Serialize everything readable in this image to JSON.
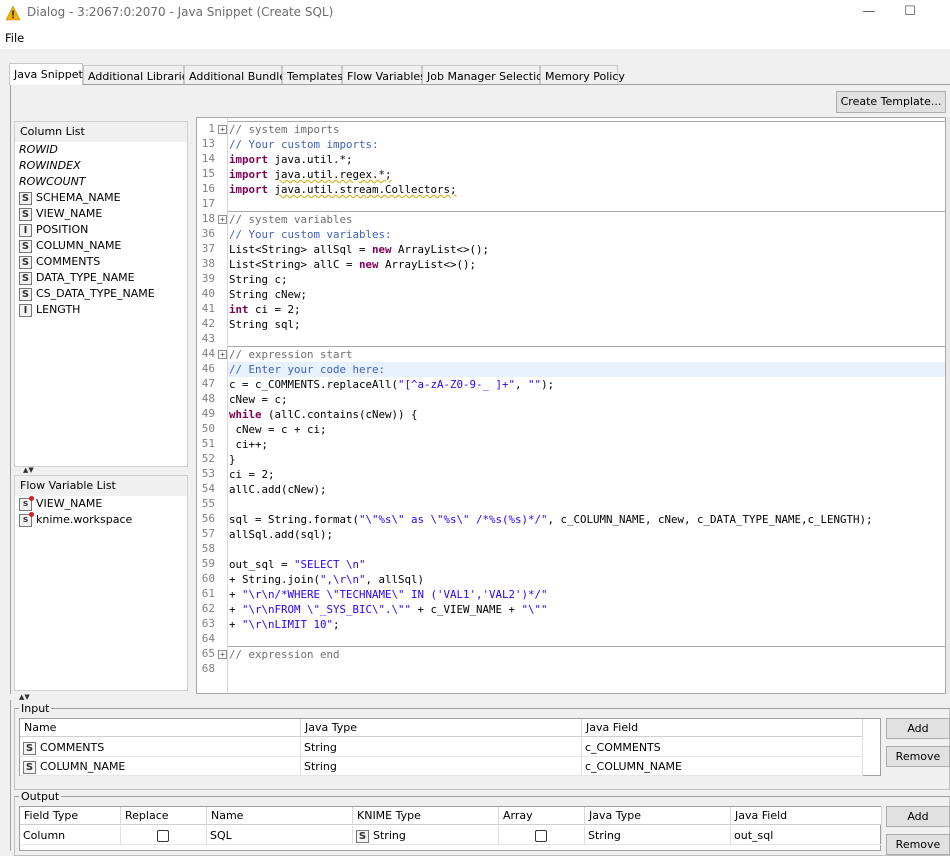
{
  "window": {
    "title": "Dialog - 3:2067:0:2070 - Java Snippet (Create SQL)",
    "minimize_glyph": "—",
    "maximize_glyph": "☐"
  },
  "menu": {
    "file": "File"
  },
  "tabs": [
    "Java Snippet",
    "Additional Libraries",
    "Additional Bundles",
    "Templates",
    "Flow Variables",
    "Job Manager Selection",
    "Memory Policy"
  ],
  "toolbar": {
    "create_template": "Create Template..."
  },
  "column_list": {
    "header": "Column List",
    "items": [
      {
        "type": "",
        "label": "ROWID"
      },
      {
        "type": "",
        "label": "ROWINDEX"
      },
      {
        "type": "",
        "label": "ROWCOUNT"
      },
      {
        "type": "S",
        "label": "SCHEMA_NAME"
      },
      {
        "type": "S",
        "label": "VIEW_NAME"
      },
      {
        "type": "I",
        "label": "POSITION"
      },
      {
        "type": "S",
        "label": "COLUMN_NAME"
      },
      {
        "type": "S",
        "label": "COMMENTS"
      },
      {
        "type": "S",
        "label": "DATA_TYPE_NAME"
      },
      {
        "type": "S",
        "label": "CS_DATA_TYPE_NAME"
      },
      {
        "type": "I",
        "label": "LENGTH"
      }
    ]
  },
  "flow_variable_list": {
    "header": "Flow Variable List",
    "items": [
      {
        "type": "s",
        "label": "VIEW_NAME"
      },
      {
        "type": "s",
        "label": "knime.workspace"
      }
    ]
  },
  "code_lines": [
    {
      "n": "1",
      "fold": true,
      "guard": false,
      "t": "// system imports"
    },
    {
      "n": "13",
      "fold": false,
      "guard": true,
      "t": "// Your custom imports:"
    },
    {
      "n": "14",
      "fold": false,
      "guard": false,
      "t": "import java.util.*;"
    },
    {
      "n": "15",
      "fold": false,
      "guard": false,
      "t": "import java.util.regex.*;"
    },
    {
      "n": "16",
      "fold": false,
      "guard": false,
      "t": "import java.util.stream.Collectors;"
    },
    {
      "n": "17",
      "fold": false,
      "guard": false,
      "t": ""
    },
    {
      "n": "18",
      "fold": true,
      "guard": false,
      "t": "// system variables"
    },
    {
      "n": "36",
      "fold": false,
      "guard": true,
      "t": "// Your custom variables:"
    },
    {
      "n": "37",
      "fold": false,
      "guard": false,
      "t": "List<String> allSql = new ArrayList<>();"
    },
    {
      "n": "38",
      "fold": false,
      "guard": false,
      "t": "List<String> allC = new ArrayList<>();"
    },
    {
      "n": "39",
      "fold": false,
      "guard": false,
      "t": "String c;"
    },
    {
      "n": "40",
      "fold": false,
      "guard": false,
      "t": "String cNew;"
    },
    {
      "n": "41",
      "fold": false,
      "guard": false,
      "t": "int ci = 2;"
    },
    {
      "n": "42",
      "fold": false,
      "guard": false,
      "t": "String sql;"
    },
    {
      "n": "43",
      "fold": false,
      "guard": false,
      "t": ""
    },
    {
      "n": "44",
      "fold": true,
      "guard": false,
      "t": "// expression start"
    },
    {
      "n": "46",
      "fold": false,
      "guard": true,
      "t": "// Enter your code here:"
    },
    {
      "n": "47",
      "fold": false,
      "guard": false,
      "t": "c = c_COMMENTS.replaceAll(\"[^a-zA-Z0-9-_ ]+\", \"\");"
    },
    {
      "n": "48",
      "fold": false,
      "guard": false,
      "t": "cNew = c;"
    },
    {
      "n": "49",
      "fold": false,
      "guard": false,
      "t": "while (allC.contains(cNew)) {"
    },
    {
      "n": "50",
      "fold": false,
      "guard": false,
      "t": " cNew = c + ci;"
    },
    {
      "n": "51",
      "fold": false,
      "guard": false,
      "t": " ci++;"
    },
    {
      "n": "52",
      "fold": false,
      "guard": false,
      "t": "}"
    },
    {
      "n": "53",
      "fold": false,
      "guard": false,
      "t": "ci = 2;"
    },
    {
      "n": "54",
      "fold": false,
      "guard": false,
      "t": "allC.add(cNew);"
    },
    {
      "n": "55",
      "fold": false,
      "guard": false,
      "t": ""
    },
    {
      "n": "56",
      "fold": false,
      "guard": false,
      "t": "sql = String.format(\"\\\"%s\\\" as \\\"%s\\\" /*%s(%s)*/\", c_COLUMN_NAME, cNew, c_DATA_TYPE_NAME,c_LENGTH);"
    },
    {
      "n": "57",
      "fold": false,
      "guard": false,
      "t": "allSql.add(sql);"
    },
    {
      "n": "58",
      "fold": false,
      "guard": false,
      "t": ""
    },
    {
      "n": "59",
      "fold": false,
      "guard": false,
      "t": "out_sql = \"SELECT \\n\""
    },
    {
      "n": "60",
      "fold": false,
      "guard": false,
      "t": "+ String.join(\",\\r\\n\", allSql)"
    },
    {
      "n": "61",
      "fold": false,
      "guard": false,
      "t": "+ \"\\r\\n/*WHERE \\\"TECHNAME\\\" IN ('VAL1','VAL2')*/\""
    },
    {
      "n": "62",
      "fold": false,
      "guard": false,
      "t": "+ \"\\r\\nFROM \\\"_SYS_BIC\\\".\\\"\" + c_VIEW_NAME + \"\\\"\""
    },
    {
      "n": "63",
      "fold": false,
      "guard": false,
      "t": "+ \"\\r\\nLIMIT 10\";"
    },
    {
      "n": "64",
      "fold": false,
      "guard": false,
      "t": ""
    },
    {
      "n": "65",
      "fold": true,
      "guard": false,
      "t": "// expression end"
    },
    {
      "n": "68",
      "fold": false,
      "guard": false,
      "t": ""
    }
  ],
  "input": {
    "label": "Input",
    "columns": [
      "Name",
      "Java Type",
      "Java Field"
    ],
    "rows": [
      {
        "badge": "S",
        "name": "COMMENTS",
        "java_type": "String",
        "java_field": "c_COMMENTS"
      },
      {
        "badge": "S",
        "name": "COLUMN_NAME",
        "java_type": "String",
        "java_field": "c_COLUMN_NAME"
      }
    ],
    "add": "Add",
    "remove": "Remove"
  },
  "output": {
    "label": "Output",
    "columns": [
      "Field Type",
      "Replace",
      "Name",
      "KNIME Type",
      "Array",
      "Java Type",
      "Java Field"
    ],
    "rows": [
      {
        "field_type": "Column",
        "replace": false,
        "name": "SQL",
        "knime_badge": "S",
        "knime_type": "String",
        "array": false,
        "java_type": "String",
        "java_field": "out_sql"
      }
    ],
    "add": "Add",
    "remove": "Remove"
  },
  "colors": {
    "warning": "#f2b200",
    "keyword": "#7f0055",
    "string": "#2a00ff",
    "comment": "#6f6f6f",
    "tag_comment": "#3f5fbf",
    "line_highlight": "#e8f2fe"
  }
}
